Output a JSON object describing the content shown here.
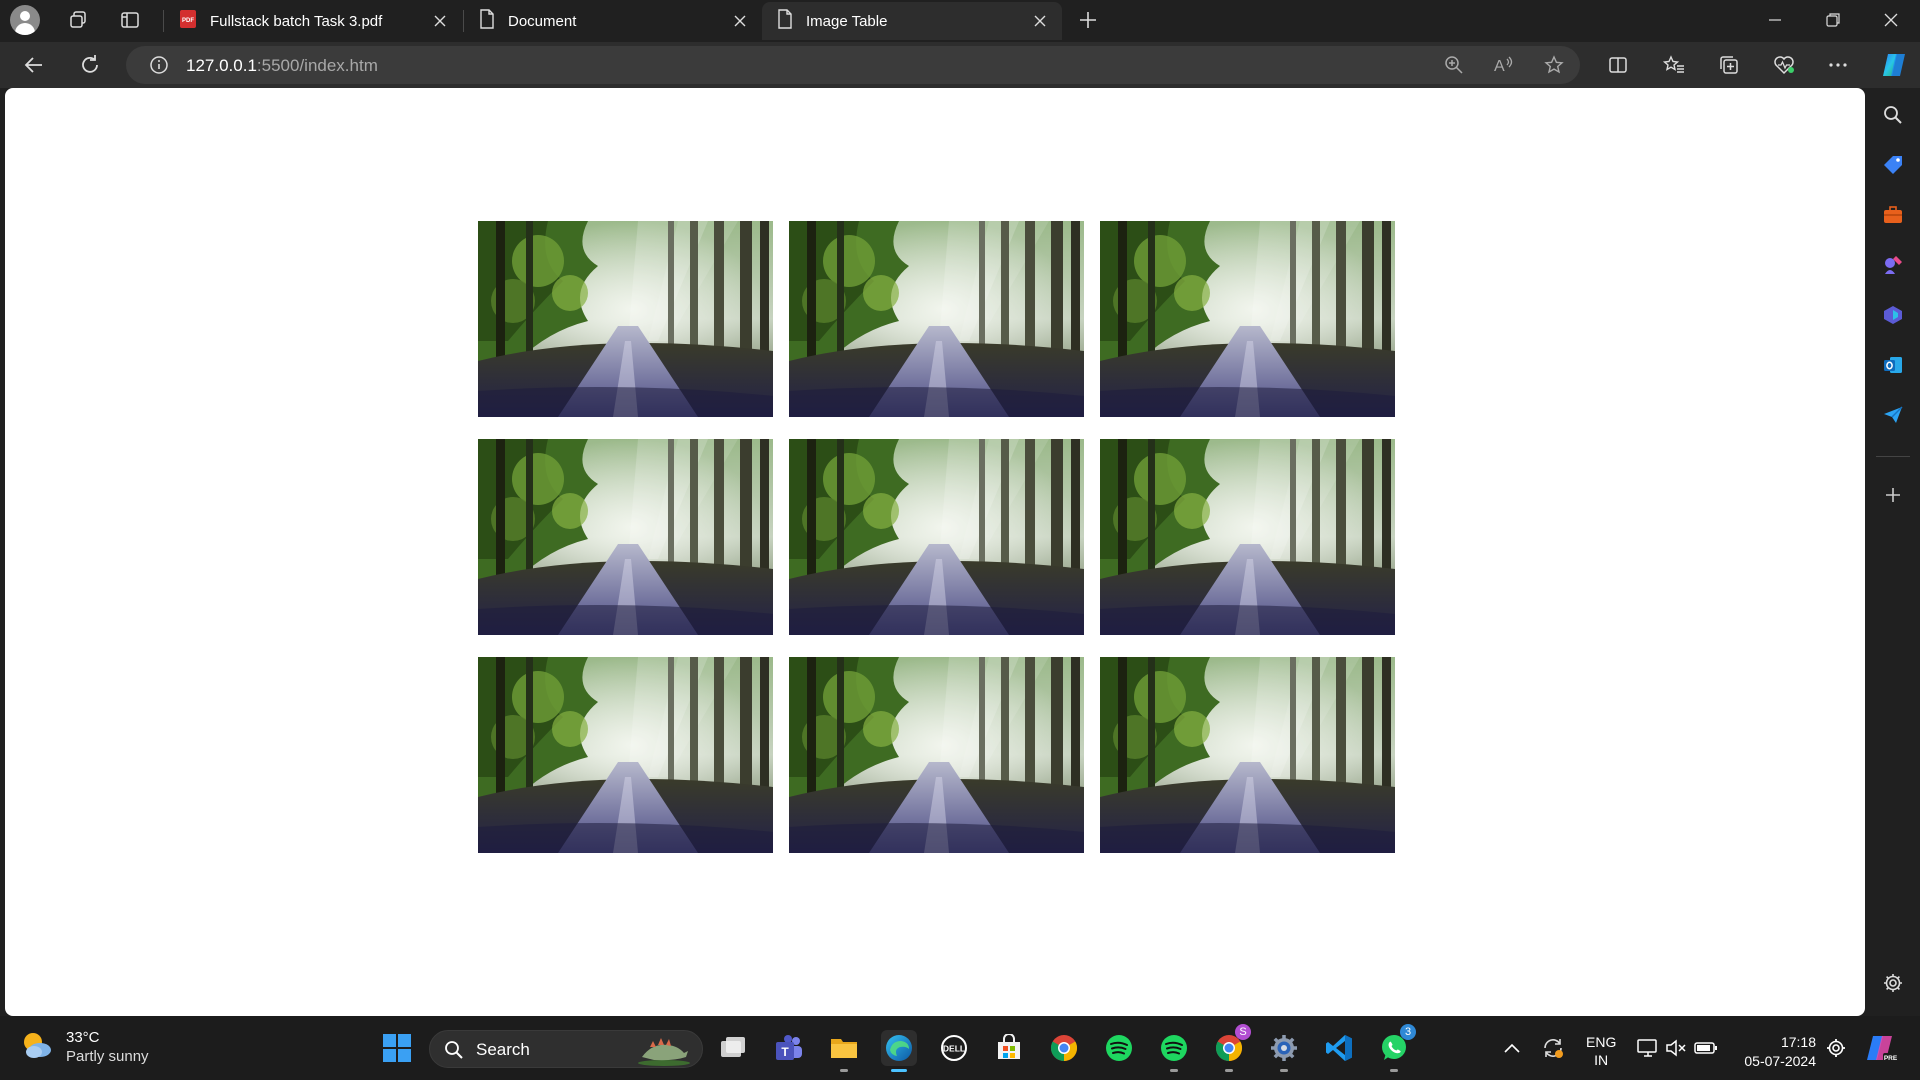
{
  "browser": {
    "tabs": [
      {
        "label": "Fullstack batch Task 3.pdf",
        "icon": "pdf-icon",
        "active": false
      },
      {
        "label": "Document",
        "icon": "page-icon",
        "active": false
      },
      {
        "label": "Image Table",
        "icon": "page-icon",
        "active": true
      }
    ],
    "url_host": "127.0.0.1",
    "url_path": ":5500/index.htm"
  },
  "page": {
    "image_alt": "Forest road with sunlight",
    "grid": {
      "rows": 3,
      "columns": 3
    }
  },
  "sidebar": {
    "icons": [
      "search-icon",
      "shopping-tag-icon",
      "tools-briefcase-icon",
      "games-icon",
      "copilot-icon",
      "outlook-icon",
      "send-icon",
      "add-icon",
      "settings-icon"
    ]
  },
  "taskbar": {
    "weather": {
      "temp": "33°C",
      "desc": "Partly sunny"
    },
    "search_label": "Search",
    "apps": [
      "task-view",
      "teams",
      "file-explorer",
      "edge",
      "dell",
      "microsoft-store",
      "chrome",
      "spotify",
      "spotify",
      "chrome-profile",
      "settings",
      "vscode",
      "whatsapp"
    ],
    "chrome_profile_badge": "S",
    "whatsapp_badge": "3",
    "lang_line1": "ENG",
    "lang_line2": "IN",
    "time": "17:18",
    "date": "05-07-2024"
  }
}
